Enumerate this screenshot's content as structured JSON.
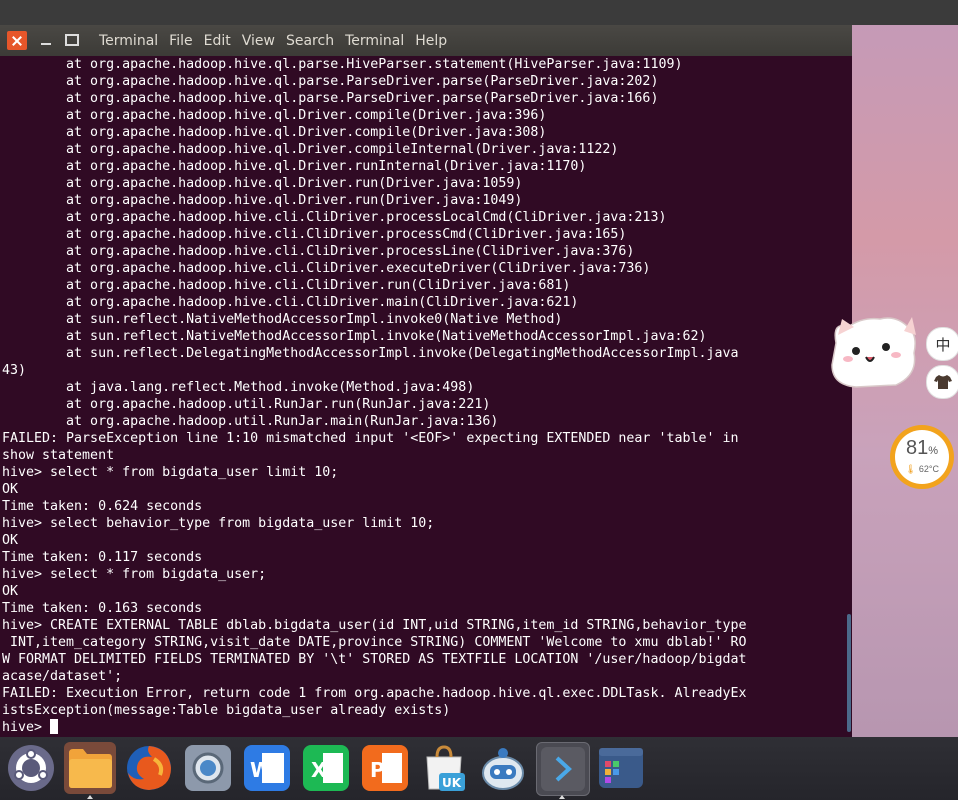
{
  "window": {
    "menu": [
      "Terminal",
      "File",
      "Edit",
      "View",
      "Search",
      "Terminal",
      "Help"
    ]
  },
  "terminal": {
    "lines": [
      "        at org.apache.hadoop.hive.ql.parse.HiveParser.statement(HiveParser.java:1109)",
      "        at org.apache.hadoop.hive.ql.parse.ParseDriver.parse(ParseDriver.java:202)",
      "        at org.apache.hadoop.hive.ql.parse.ParseDriver.parse(ParseDriver.java:166)",
      "        at org.apache.hadoop.hive.ql.Driver.compile(Driver.java:396)",
      "        at org.apache.hadoop.hive.ql.Driver.compile(Driver.java:308)",
      "        at org.apache.hadoop.hive.ql.Driver.compileInternal(Driver.java:1122)",
      "        at org.apache.hadoop.hive.ql.Driver.runInternal(Driver.java:1170)",
      "        at org.apache.hadoop.hive.ql.Driver.run(Driver.java:1059)",
      "        at org.apache.hadoop.hive.ql.Driver.run(Driver.java:1049)",
      "        at org.apache.hadoop.hive.cli.CliDriver.processLocalCmd(CliDriver.java:213)",
      "        at org.apache.hadoop.hive.cli.CliDriver.processCmd(CliDriver.java:165)",
      "        at org.apache.hadoop.hive.cli.CliDriver.processLine(CliDriver.java:376)",
      "        at org.apache.hadoop.hive.cli.CliDriver.executeDriver(CliDriver.java:736)",
      "        at org.apache.hadoop.hive.cli.CliDriver.run(CliDriver.java:681)",
      "        at org.apache.hadoop.hive.cli.CliDriver.main(CliDriver.java:621)",
      "        at sun.reflect.NativeMethodAccessorImpl.invoke0(Native Method)",
      "        at sun.reflect.NativeMethodAccessorImpl.invoke(NativeMethodAccessorImpl.java:62)",
      "        at sun.reflect.DelegatingMethodAccessorImpl.invoke(DelegatingMethodAccessorImpl.java",
      "43)",
      "        at java.lang.reflect.Method.invoke(Method.java:498)",
      "        at org.apache.hadoop.util.RunJar.run(RunJar.java:221)",
      "        at org.apache.hadoop.util.RunJar.main(RunJar.java:136)",
      "FAILED: ParseException line 1:10 mismatched input '<EOF>' expecting EXTENDED near 'table' in",
      "show statement",
      "hive> select * from bigdata_user limit 10;",
      "OK",
      "Time taken: 0.624 seconds",
      "hive> select behavior_type from bigdata_user limit 10;",
      "OK",
      "Time taken: 0.117 seconds",
      "hive> select * from bigdata_user;",
      "OK",
      "Time taken: 0.163 seconds",
      "hive> CREATE EXTERNAL TABLE dblab.bigdata_user(id INT,uid STRING,item_id STRING,behavior_type",
      " INT,item_category STRING,visit_date DATE,province STRING) COMMENT 'Welcome to xmu dblab!' RO",
      "W FORMAT DELIMITED FIELDS TERMINATED BY '\\t' STORED AS TEXTFILE LOCATION '/user/hadoop/bigdat",
      "acase/dataset';",
      "FAILED: Execution Error, return code 1 from org.apache.hadoop.hive.ql.exec.DDLTask. AlreadyEx",
      "istsException(message:Table bigdata_user already exists)"
    ],
    "prompt": "hive> "
  },
  "widgets": {
    "lang_button": "中",
    "skin_icon": "shirt-icon",
    "gauge_value": "81",
    "gauge_unit": "%",
    "gauge_temp": "62°C"
  },
  "dock": {
    "items": [
      {
        "icon": "ubuntu-logo-icon"
      },
      {
        "icon": "files-icon"
      },
      {
        "icon": "firefox-icon"
      },
      {
        "icon": "screenshot-icon"
      },
      {
        "icon": "wps-writer-icon"
      },
      {
        "icon": "wps-spreadsheet-icon"
      },
      {
        "icon": "wps-presentation-icon"
      },
      {
        "icon": "software-center-icon"
      },
      {
        "icon": "robot-updater-icon"
      },
      {
        "icon": "terminal-icon"
      },
      {
        "icon": "workspace-switcher-icon"
      }
    ]
  }
}
